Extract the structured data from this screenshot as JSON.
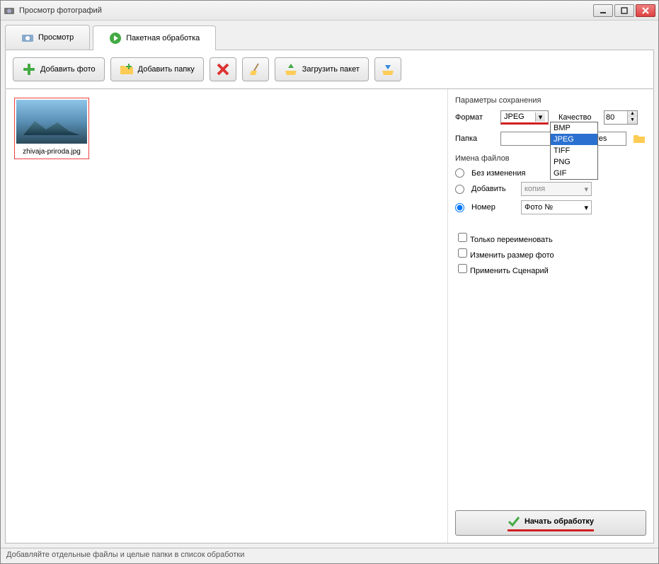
{
  "window": {
    "title": "Просмотр фотографий"
  },
  "tabs": {
    "view": "Просмотр",
    "batch": "Пакетная обработка"
  },
  "toolbar": {
    "add_photo": "Добавить фото",
    "add_folder": "Добавить папку",
    "load_batch": "Загрузить пакет"
  },
  "thumb": {
    "filename": "zhivaja-priroda.jpg"
  },
  "save_params": {
    "title": "Параметры сохранения",
    "format_label": "Формат",
    "format_value": "JPEG",
    "format_options": [
      "BMP",
      "JPEG",
      "TIFF",
      "PNG",
      "GIF"
    ],
    "quality_label": "Качество",
    "quality_value": "80",
    "folder_label": "Папка",
    "folder_value": "ublic\\Pictures"
  },
  "filenames": {
    "title": "Имена файлов",
    "no_change": "Без изменения",
    "add": "Добавить",
    "add_value": "копия",
    "number": "Номер",
    "number_value": "Фото №"
  },
  "checks": {
    "rename_only": "Только переименовать",
    "resize": "Изменить размер фото",
    "apply_scenario": "Применить Сценарий"
  },
  "start_button": "Начать обработку",
  "statusbar": "Добавляйте отдельные файлы и целые папки в список обработки"
}
